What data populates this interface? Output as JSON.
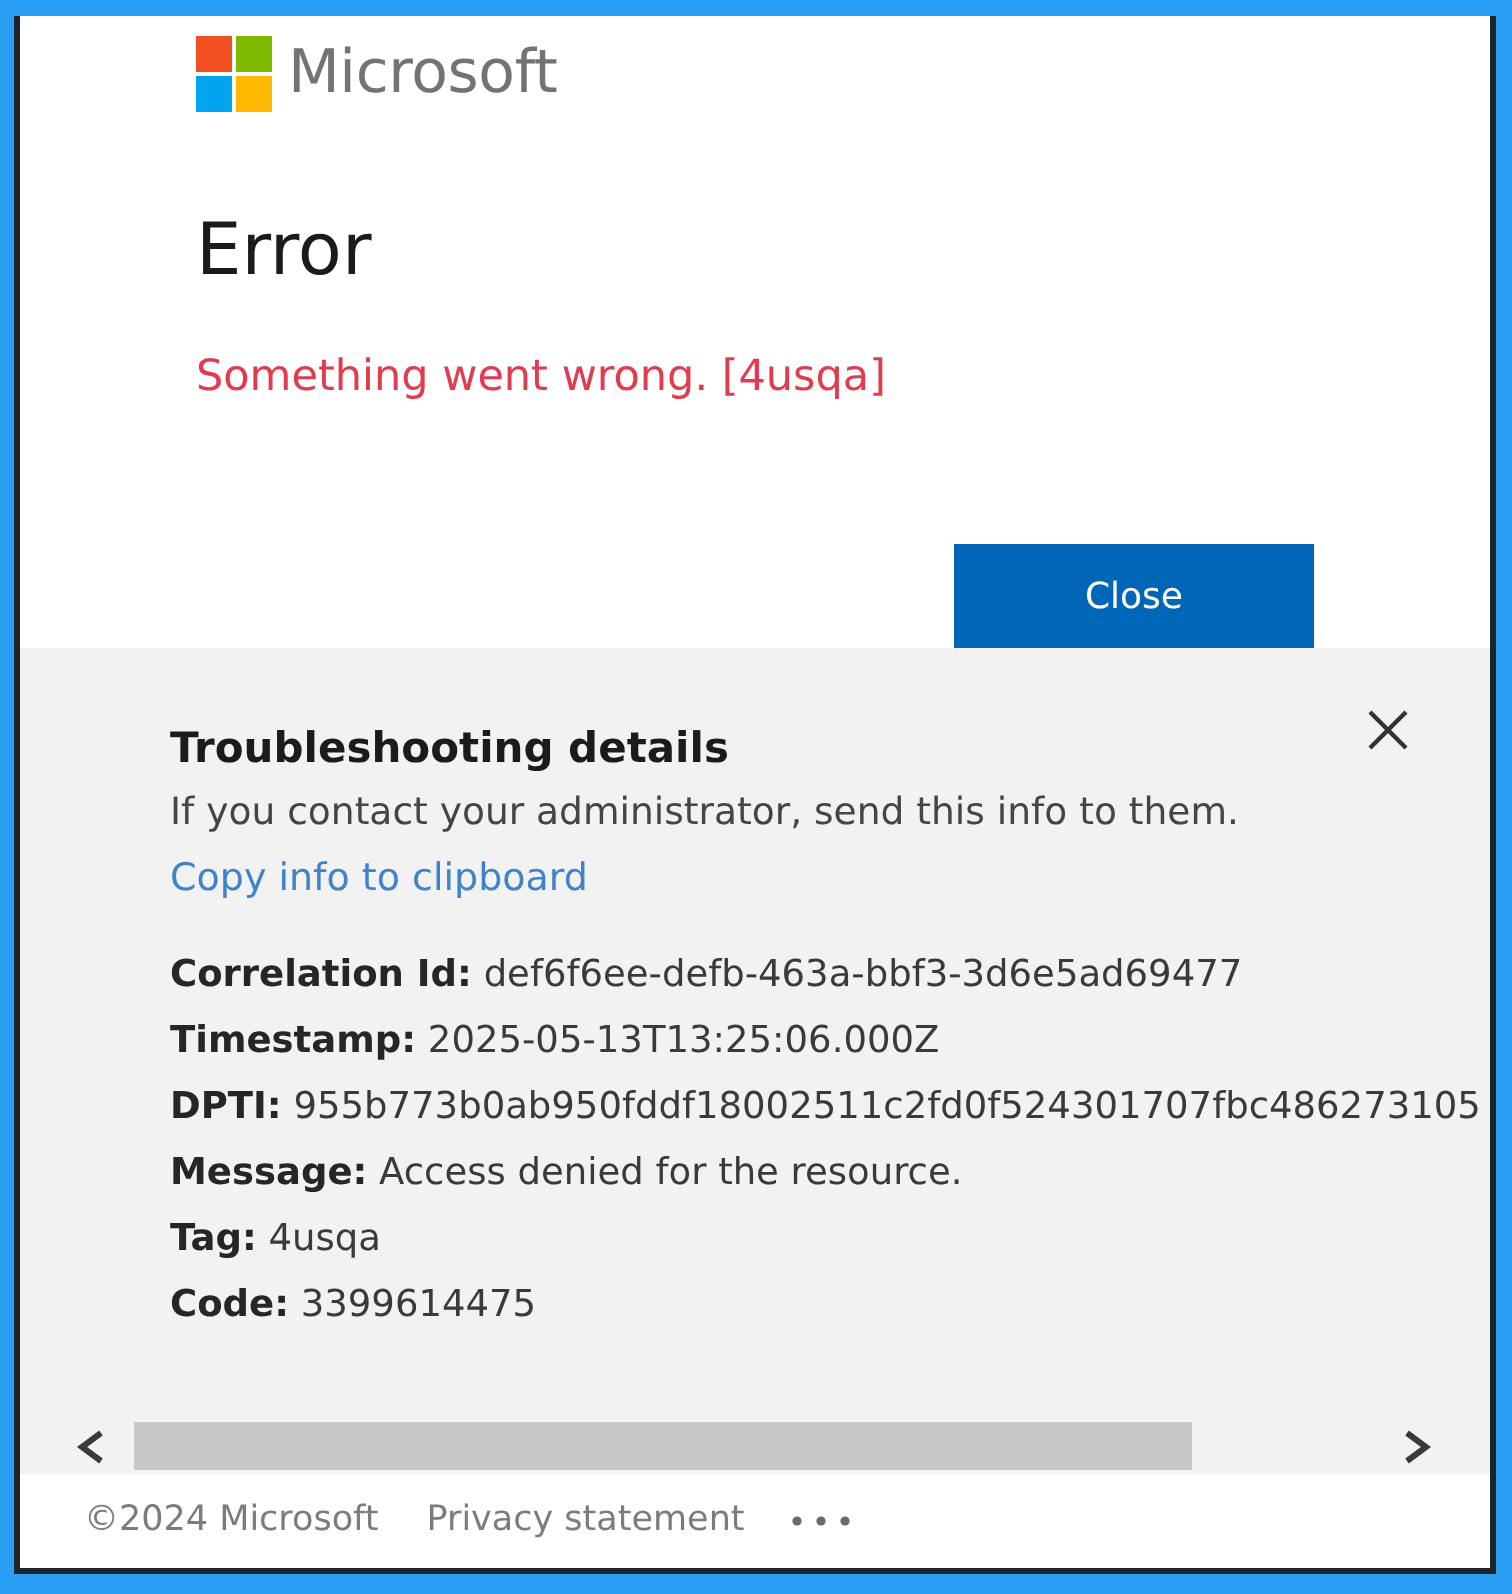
{
  "brand": {
    "name": "Microsoft"
  },
  "error": {
    "title": "Error",
    "message": "Something went wrong. [4usqa]",
    "close_button": "Close"
  },
  "troubleshooting": {
    "title": "Troubleshooting details",
    "description": "If you contact your administrator, send this info to them.",
    "copy_link": "Copy info to clipboard",
    "details": [
      "**Correlation Id:** def6f6ee-defb-463a-bbf3-3d6e5ad69477",
      "**Timestamp:** 2025-05-13T13:25:06.000Z",
      "**DPTI:** 955b773b0ab950fddf18002511c2fd0f524301707fbc486273105",
      "**Message:** Access denied for the resource.",
      "**Tag:** 4usqa",
      "**Code:** 3399614475"
    ]
  },
  "footer": {
    "copyright": "©2024 Microsoft",
    "links": [
      "Privacy statement"
    ]
  }
}
